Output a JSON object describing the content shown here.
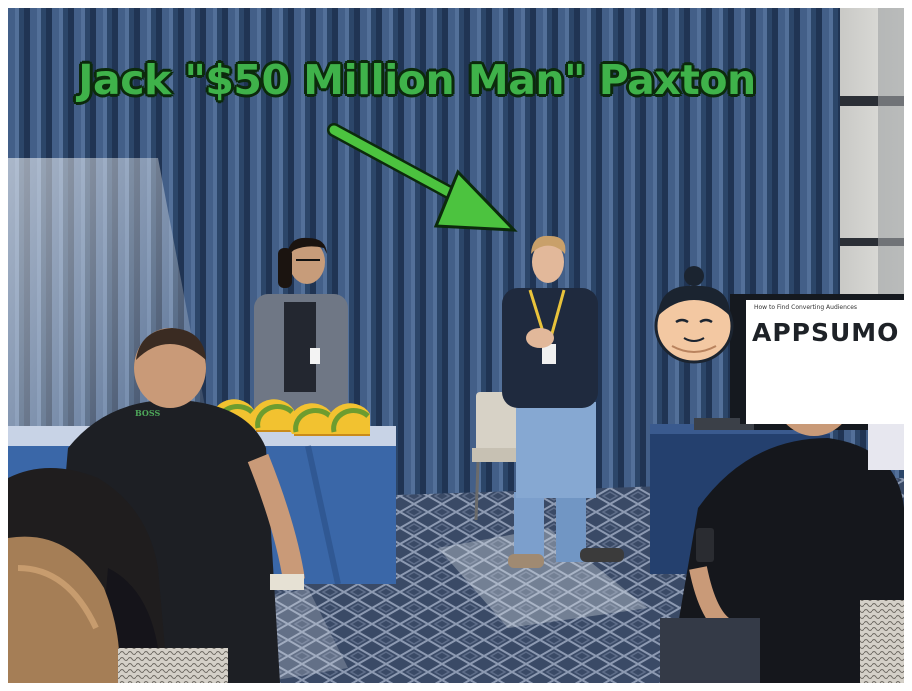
{
  "overlay": {
    "headline": "Jack \"$50 Million Man\" Paxton",
    "headline_color": "#3fb24a",
    "arrow_color": "#4cc33f"
  },
  "slide": {
    "caption": "How to Find Converting Audiences",
    "logo_text": "APPSUMO"
  },
  "shirt": {
    "label": "BOSS"
  },
  "icons": [
    "taco-icon",
    "sumo-mascot-icon",
    "arrow-icon"
  ]
}
